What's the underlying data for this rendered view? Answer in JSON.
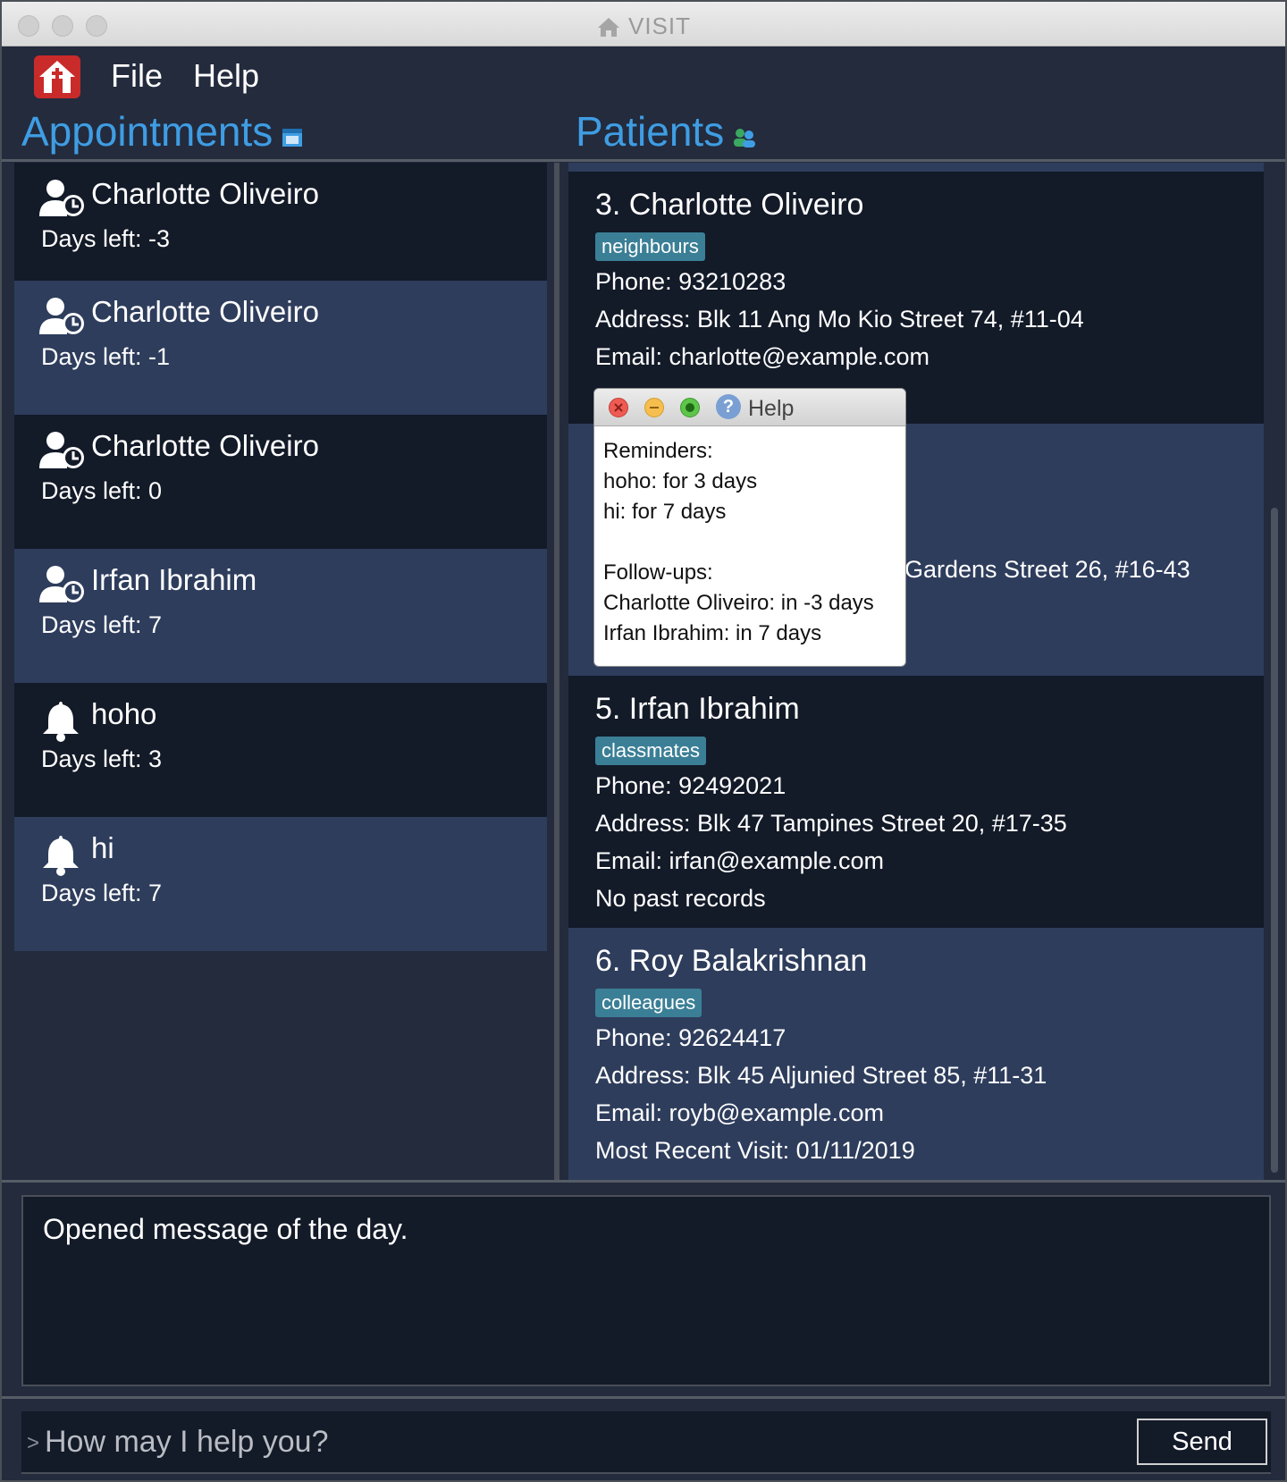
{
  "window": {
    "title": "VISIT"
  },
  "menu": {
    "file": "File",
    "help": "Help"
  },
  "appointments": {
    "title": "Appointments",
    "items": [
      {
        "icon": "user-clock-icon",
        "name": "Charlotte Oliveiro",
        "days": "Days left: -3"
      },
      {
        "icon": "user-clock-icon",
        "name": "Charlotte Oliveiro",
        "days": "Days left: -1"
      },
      {
        "icon": "user-clock-icon",
        "name": "Charlotte Oliveiro",
        "days": "Days left: 0"
      },
      {
        "icon": "user-clock-icon",
        "name": "Irfan Ibrahim",
        "days": "Days left: 7"
      },
      {
        "icon": "bell-icon",
        "name": "hoho",
        "days": "Days left: 3"
      },
      {
        "icon": "bell-icon",
        "name": "hi",
        "days": "Days left: 7"
      }
    ]
  },
  "patients": {
    "title": "Patients",
    "cards": [
      {
        "name": "3.  Charlotte Oliveiro",
        "tag": "neighbours",
        "phone": "Phone: 93210283",
        "address": "Address: Blk 11 Ang Mo Kio Street 74, #11-04",
        "email": "Email: charlotte@example.com",
        "record": ""
      },
      {
        "name": "",
        "tag": "",
        "phone": "",
        "address": "Gardens Street 26, #16-43",
        "email": "",
        "record": ""
      },
      {
        "name": "5.  Irfan Ibrahim",
        "tag": "classmates",
        "phone": "Phone: 92492021",
        "address": "Address: Blk 47 Tampines Street 20, #17-35",
        "email": "Email: irfan@example.com",
        "record": "No past records"
      },
      {
        "name": "6.  Roy Balakrishnan",
        "tag": "colleagues",
        "phone": "Phone: 92624417",
        "address": "Address: Blk 45 Aljunied Street 85, #11-31",
        "email": "Email: royb@example.com",
        "record": "Most Recent Visit: 01/11/2019"
      }
    ]
  },
  "help_popup": {
    "title": "Help",
    "lines": [
      "Reminders:",
      "hoho: for 3 days",
      "hi: for 7 days",
      "",
      "Follow-ups:",
      "Charlotte Oliveiro: in -3 days",
      "Irfan Ibrahim: in 7 days"
    ]
  },
  "result": {
    "text": "Opened message of the day."
  },
  "command": {
    "prompt": ">",
    "placeholder": "How may I help you?",
    "send_label": "Send"
  }
}
